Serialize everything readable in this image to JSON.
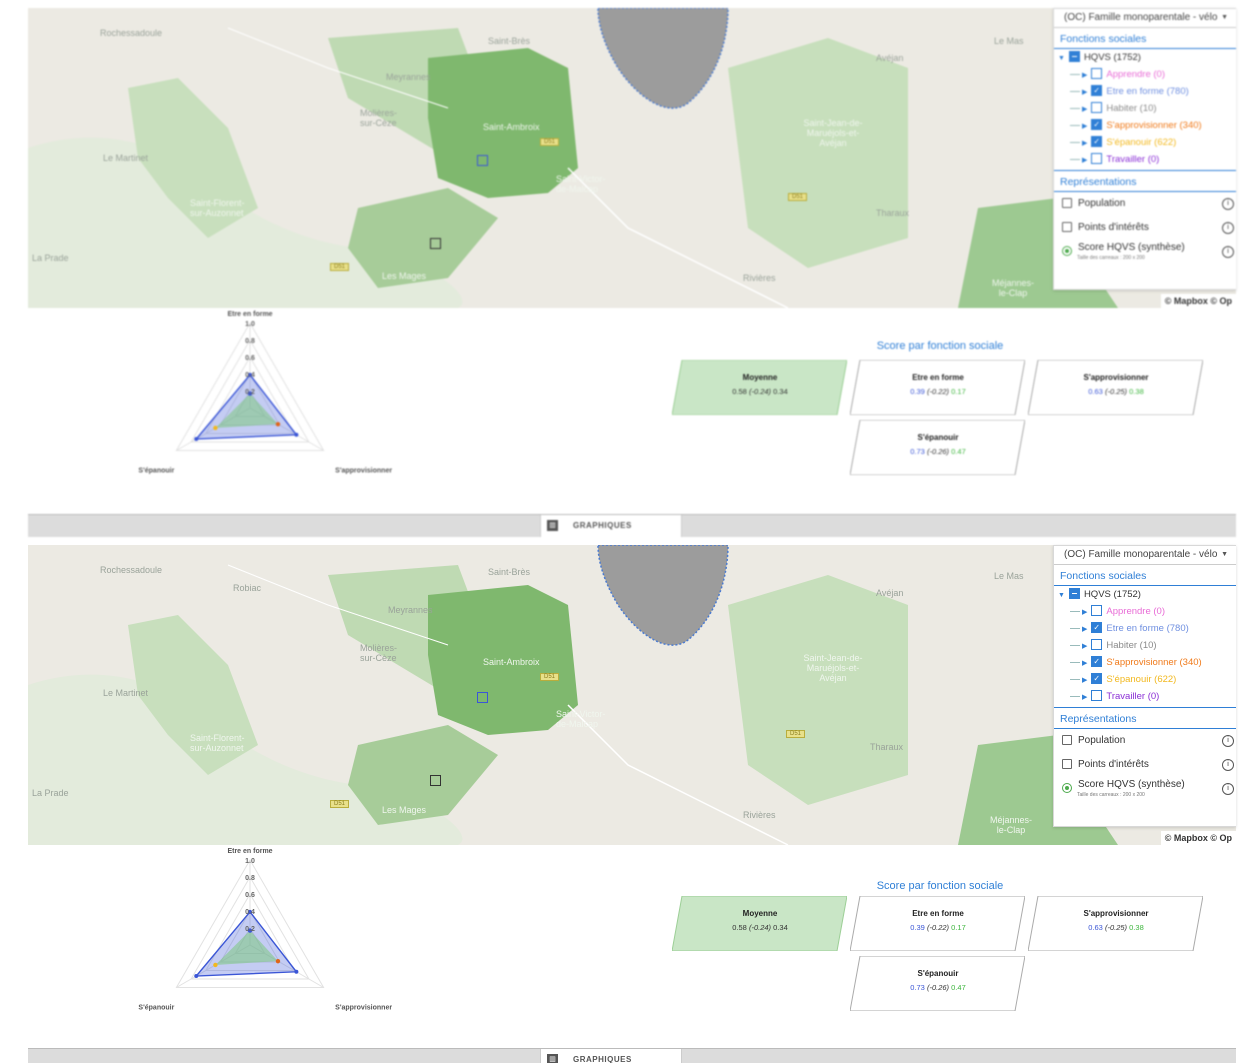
{
  "panels": [
    {
      "id": "top",
      "map": {
        "places": [
          {
            "name": "Rochessadoule"
          },
          {
            "name": "Saint-Brès"
          },
          {
            "name": "Meyrannes"
          },
          {
            "name": "Molières-sur-Cèze"
          },
          {
            "name": "Saint-Ambroix"
          },
          {
            "name": "Le Martinet"
          },
          {
            "name": "Saint-Victor-de-Malcap"
          },
          {
            "name": "Saint-Florent-sur-Auzonnet"
          },
          {
            "name": "Les Mages"
          },
          {
            "name": "Saint-Jean-de-Maruéjols-et-Avéjan"
          },
          {
            "name": "Le Mas"
          },
          {
            "name": "Avéjan"
          },
          {
            "name": "Tharaux"
          },
          {
            "name": "Rivières"
          },
          {
            "name": "Méjannes-le-Clap"
          },
          {
            "name": "La Prade"
          },
          {
            "name": "Robiac"
          }
        ],
        "attribution": "© Mapbox © Op"
      },
      "controls": {
        "profile": "(OC) Famille monoparentale - vélo",
        "sections": {
          "fonctions": "Fonctions sociales",
          "representations": "Représentations"
        },
        "root": {
          "label": "HQVS (1752)"
        },
        "functions": [
          {
            "label": "Apprendre (0)",
            "color": "#e86bd6",
            "checked": false
          },
          {
            "label": "Etre en forme (780)",
            "color": "#6f8fe0",
            "checked": true
          },
          {
            "label": "Habiter (10)",
            "color": "#8a8a8a",
            "checked": false
          },
          {
            "label": "S'approvisionner (340)",
            "color": "#f07a1a",
            "checked": true
          },
          {
            "label": "S'épanouir (622)",
            "color": "#f2b81e",
            "checked": true
          },
          {
            "label": "Travailler (0)",
            "color": "#8b2fd6",
            "checked": false
          }
        ],
        "options": [
          {
            "label": "Population",
            "type": "checkbox"
          },
          {
            "label": "Points d'intérêts",
            "type": "checkbox"
          },
          {
            "label": "Score HQVS (synthèse)",
            "type": "radio",
            "sub": "Taille des carreaux : 200 x 200"
          }
        ]
      },
      "radar": {
        "axes": [
          "Etre en forme",
          "S'approvisionner",
          "S'épanouir"
        ],
        "ticks": [
          "1.0",
          "0.8",
          "0.6",
          "0.4",
          "0.2"
        ]
      },
      "scores": {
        "title": "Score par fonction sociale",
        "cards": [
          {
            "title": "Moyenne",
            "v1": "0.58",
            "v2": "(-0.24)",
            "v3": "0.34"
          },
          {
            "title": "Etre en forme",
            "v1": "0.39",
            "v2": "(-0.22)",
            "v3": "0.17"
          },
          {
            "title": "S'approvisionner",
            "v1": "0.63",
            "v2": "(-0.25)",
            "v3": "0.38"
          },
          {
            "title": "S'épanouir",
            "v1": "0.73",
            "v2": "(-0.26)",
            "v3": "0.47"
          }
        ]
      },
      "graph_button": "GRAPHIQUES"
    }
  ],
  "chart_data": {
    "type": "radar",
    "categories": [
      "Etre en forme",
      "S'approvisionner",
      "S'épanouir"
    ],
    "rlim": [
      0,
      1.0
    ],
    "ticks": [
      0.2,
      0.4,
      0.6,
      0.8,
      1.0
    ],
    "series": [
      {
        "values": [
          0.39,
          0.63,
          0.73
        ],
        "color": "#3b56d6"
      },
      {
        "values": [
          0.17,
          0.38,
          0.47
        ],
        "color": "#7ec87e"
      }
    ]
  },
  "colors": {
    "accent": "#2f7fd6",
    "mean_card": "#c9e6c6",
    "series_blue": "#3b56d6",
    "series_green": "#3db53d"
  }
}
